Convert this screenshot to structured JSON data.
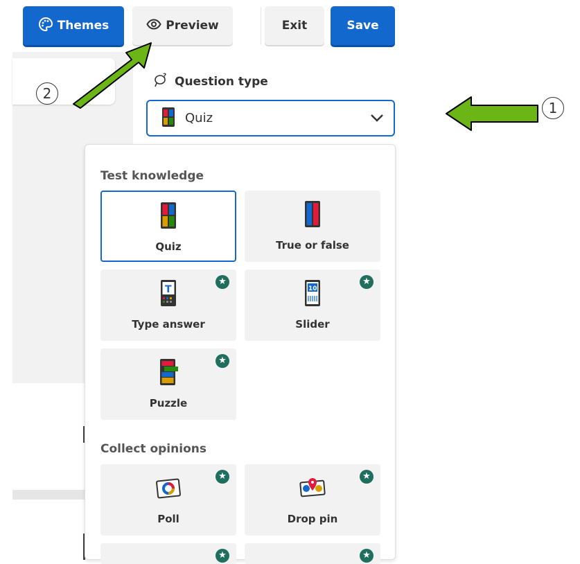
{
  "toolbar": {
    "themes_label": "Themes",
    "preview_label": "Preview",
    "exit_label": "Exit",
    "save_label": "Save"
  },
  "question_type": {
    "label": "Question type",
    "selected": "Quiz"
  },
  "dropdown": {
    "sections": [
      {
        "title": "Test knowledge",
        "items": [
          {
            "label": "Quiz",
            "selected": true,
            "premium": false
          },
          {
            "label": "True or false",
            "selected": false,
            "premium": false
          },
          {
            "label": "Type answer",
            "selected": false,
            "premium": true
          },
          {
            "label": "Slider",
            "selected": false,
            "premium": true
          },
          {
            "label": "Puzzle",
            "selected": false,
            "premium": true
          }
        ]
      },
      {
        "title": "Collect opinions",
        "items": [
          {
            "label": "Poll",
            "selected": false,
            "premium": true
          },
          {
            "label": "Drop pin",
            "selected": false,
            "premium": true
          }
        ]
      }
    ]
  },
  "annotations": {
    "marker_1": "1",
    "marker_2": "2",
    "arrow_color": "#6bb516"
  },
  "colors": {
    "accent": "#1368ce",
    "premium_badge": "#1f6e5e"
  }
}
